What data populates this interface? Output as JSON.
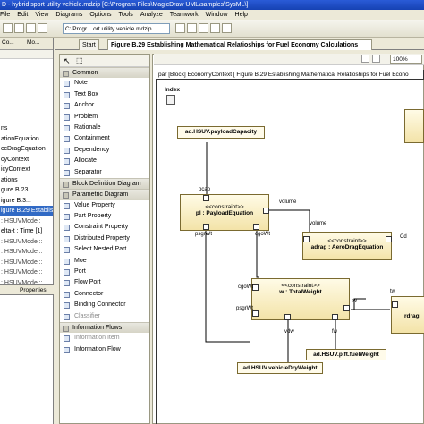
{
  "window": {
    "title": "D - hybrid sport utility vehicle.mdzip [C:\\Program Files\\MagicDraw UML\\samples\\SysML\\]"
  },
  "menu": [
    "File",
    "Edit",
    "View",
    "Diagrams",
    "Options",
    "Tools",
    "Analyze",
    "Teamwork",
    "Window",
    "Help"
  ],
  "path_field": "C:/Progr....ort utility vehicle.mdzip",
  "left_tabs": [
    "Co...",
    "Mo..."
  ],
  "tree": [
    {
      "label": "ns",
      "state": "normal"
    },
    {
      "label": "ationEquation",
      "state": "normal"
    },
    {
      "label": "ccDragEquation",
      "state": "normal"
    },
    {
      "label": "cyContext",
      "state": "normal"
    },
    {
      "label": "icyContext",
      "state": "normal"
    },
    {
      "label": "ations",
      "state": "normal"
    },
    {
      "label": "gure B.23",
      "state": "normal"
    },
    {
      "label": "igure B.3...",
      "state": "normal"
    },
    {
      "label": "igure B.29 Establis",
      "state": "selected"
    },
    {
      "label": ": HSUVModel:",
      "state": "dim"
    },
    {
      "label": "elta-t : Time [1]",
      "state": "normal"
    },
    {
      "label": ": HSUVModel::",
      "state": "dim"
    },
    {
      "label": ": HSUVModel::",
      "state": "dim"
    },
    {
      "label": ": HSUVModel::",
      "state": "dim"
    },
    {
      "label": ": HSUVModel::",
      "state": "dim"
    },
    {
      "label": ": HSUVModel::",
      "state": "dim"
    }
  ],
  "bottom_left_tabs": [
    "Properties"
  ],
  "main_tabs": [
    {
      "label": "Start",
      "active": false
    },
    {
      "label": "Figure B.29 Establishing Mathematical Relatioships for Fuel Economy Calculations",
      "active": true
    }
  ],
  "zoom": "100%",
  "palette": [
    {
      "label": "Common",
      "kind": "header"
    },
    {
      "label": "Note",
      "kind": "item"
    },
    {
      "label": "Text Box",
      "kind": "item"
    },
    {
      "label": "Anchor",
      "kind": "item"
    },
    {
      "label": "Problem",
      "kind": "item"
    },
    {
      "label": "Rationale",
      "kind": "item"
    },
    {
      "label": "Containment",
      "kind": "item"
    },
    {
      "label": "Dependency",
      "kind": "item"
    },
    {
      "label": "Allocate",
      "kind": "item"
    },
    {
      "label": "Separator",
      "kind": "item"
    },
    {
      "label": "Block Definition Diagram",
      "kind": "header"
    },
    {
      "label": "Parametric Diagram",
      "kind": "header"
    },
    {
      "label": "Value Property",
      "kind": "item"
    },
    {
      "label": "Part Property",
      "kind": "item"
    },
    {
      "label": "Constraint Property",
      "kind": "item"
    },
    {
      "label": "Distributed Property",
      "kind": "item"
    },
    {
      "label": "Select Nested Part",
      "kind": "item"
    },
    {
      "label": "Moe",
      "kind": "item"
    },
    {
      "label": "Port",
      "kind": "item"
    },
    {
      "label": "Flow Port",
      "kind": "item"
    },
    {
      "label": "Connector",
      "kind": "item"
    },
    {
      "label": "Binding Connector",
      "kind": "item"
    },
    {
      "label": "Classifier",
      "kind": "disabled"
    },
    {
      "label": "Information Flows",
      "kind": "header"
    },
    {
      "label": "Information Item",
      "kind": "disabled"
    },
    {
      "label": "Information Flow",
      "kind": "item"
    }
  ],
  "diagram": {
    "frame_label": "par [Block] EconomyContext [ Figure B.29 Establishing Mathematical Relatioships for Fuel Econo",
    "index_label": "Index",
    "props": {
      "payload": "ad.HSUV.payloadCapacity",
      "vehicle_weight": "ad.HSUV.vehicleDryWeight",
      "fuel_weight": "ad.HSUV.p.ft.fuelWeight"
    },
    "constraints": {
      "payload": {
        "stereotype": "<<constraint>>",
        "name": "pl : PayloadEquation"
      },
      "aero": {
        "stereotype": "<<constraint>>",
        "name": "adrag : AeroDragEquation"
      },
      "weight": {
        "stereotype": "<<constraint>>",
        "name": "w : TotalWeight"
      },
      "rdrag": {
        "name": "rdrag"
      }
    },
    "labels": {
      "pcap": "pcap",
      "volume1": "volume",
      "volume2": "volume",
      "psgrWt1": "psgrWt",
      "cgoWt1": "cgoWt",
      "cgoWt2": "cgoWt",
      "psgrWt2": "psgrWt",
      "tw1": "tw",
      "tw2": "tw",
      "vdw": "vdw",
      "fw": "fw",
      "cd": "Cd"
    }
  }
}
